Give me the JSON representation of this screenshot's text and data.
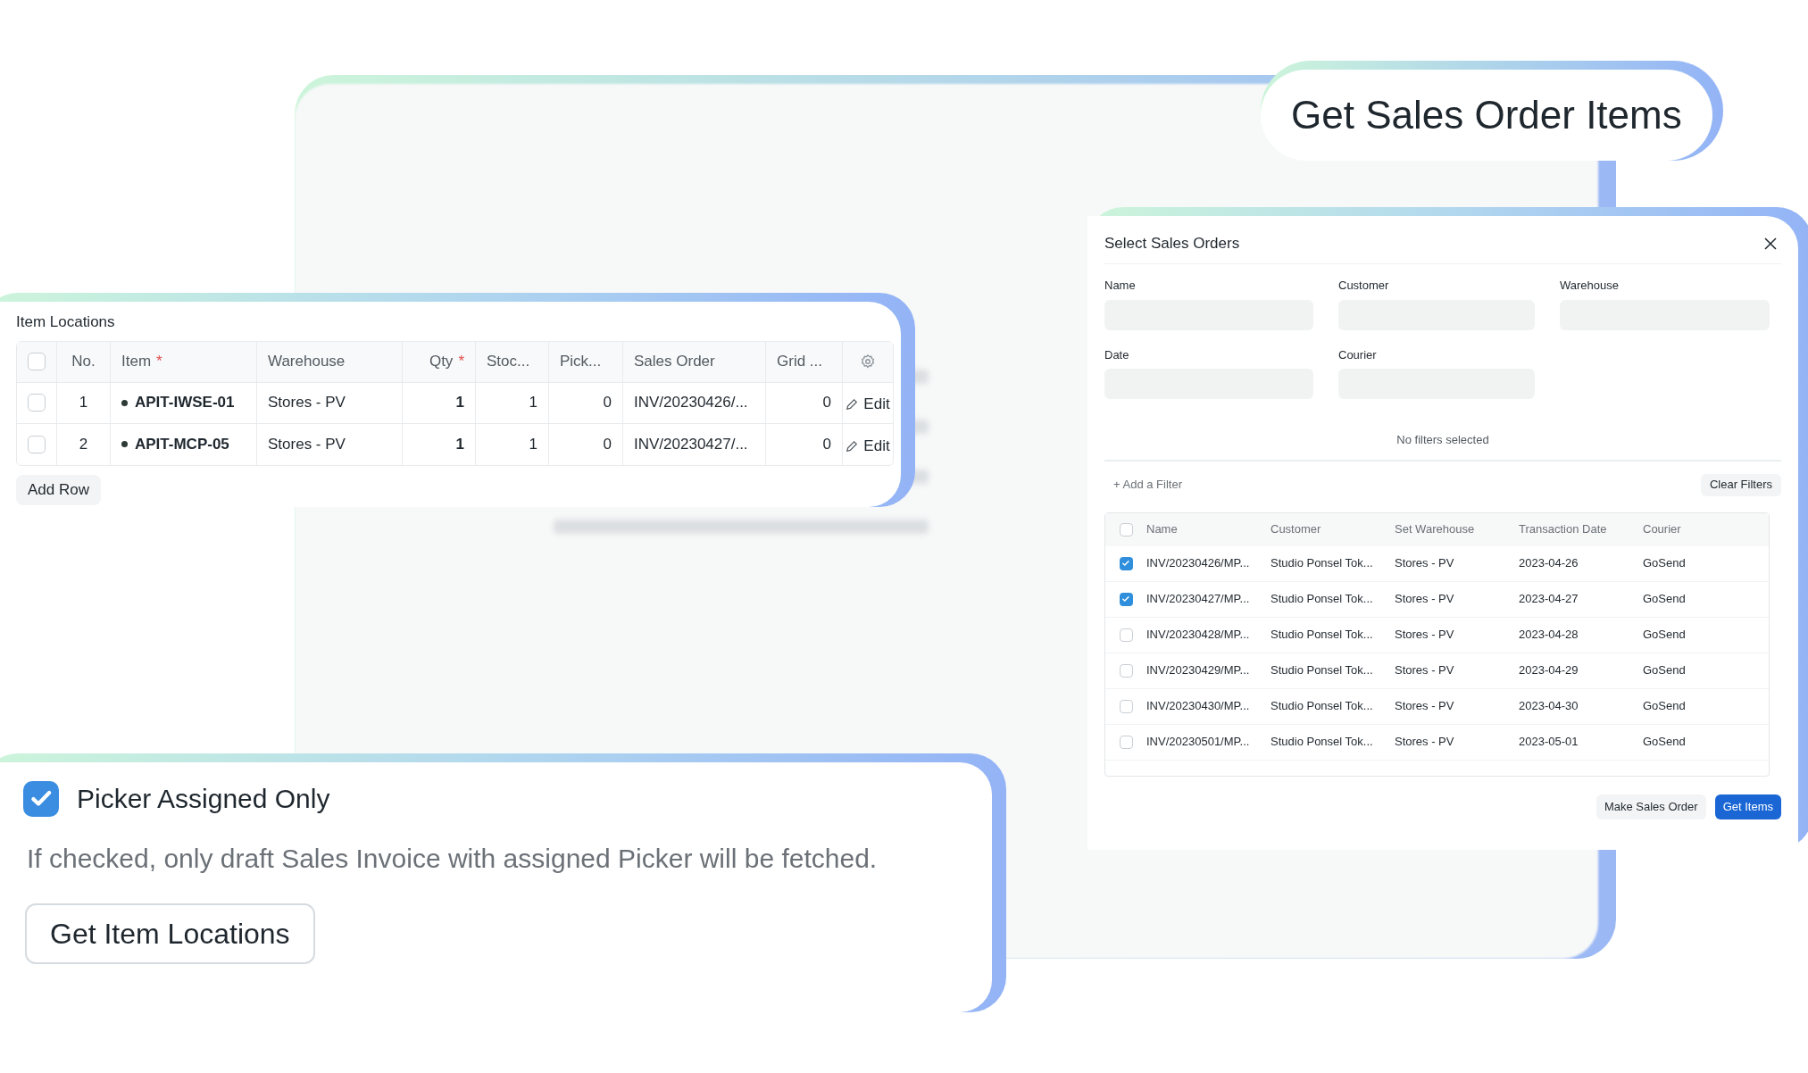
{
  "callout": {
    "title": "Get Sales Order Items"
  },
  "item_locations": {
    "title": "Item Locations",
    "select_all": {
      "checked": false
    },
    "columns": [
      {
        "label": "No."
      },
      {
        "label": "Item",
        "required_mark": "*"
      },
      {
        "label": "Warehouse"
      },
      {
        "label": "Qty",
        "required_mark": "*"
      },
      {
        "label": "Stoc..."
      },
      {
        "label": "Pick..."
      },
      {
        "label": "Sales Order"
      },
      {
        "label": "Grid ..."
      }
    ],
    "rows": [
      {
        "selected": false,
        "no": "1",
        "item": "APIT-IWSE-01",
        "warehouse": "Stores - PV",
        "qty": "1",
        "stock": "1",
        "picked": "0",
        "sales_order": "INV/20230426/...",
        "grid": "0",
        "edit": "Edit"
      },
      {
        "selected": false,
        "no": "2",
        "item": "APIT-MCP-05",
        "warehouse": "Stores - PV",
        "qty": "1",
        "stock": "1",
        "picked": "0",
        "sales_order": "INV/20230427/...",
        "grid": "0",
        "edit": "Edit"
      }
    ],
    "add_row": "Add Row"
  },
  "dialog": {
    "title": "Select Sales Orders",
    "fields": [
      {
        "label": "Name"
      },
      {
        "label": "Customer"
      },
      {
        "label": "Warehouse"
      },
      {
        "label": "Date"
      },
      {
        "label": "Courier"
      }
    ],
    "empty_state": "No filters selected",
    "add_filter": "+ Add a Filter",
    "clear_filters": "Clear Filters",
    "select_all": {
      "checked": false
    },
    "columns": [
      "Name",
      "Customer",
      "Set Warehouse",
      "Transaction Date",
      "Courier"
    ],
    "rows": [
      {
        "selected": true,
        "cells": [
          "INV/20230426/MP...",
          "Studio Ponsel Tok...",
          "Stores - PV",
          "2023-04-26",
          "GoSend"
        ]
      },
      {
        "selected": true,
        "cells": [
          "INV/20230427/MP...",
          "Studio Ponsel Tok...",
          "Stores - PV",
          "2023-04-27",
          "GoSend"
        ]
      },
      {
        "selected": false,
        "cells": [
          "INV/20230428/MP...",
          "Studio Ponsel Tok...",
          "Stores - PV",
          "2023-04-28",
          "GoSend"
        ]
      },
      {
        "selected": false,
        "cells": [
          "INV/20230429/MP...",
          "Studio Ponsel Tok...",
          "Stores - PV",
          "2023-04-29",
          "GoSend"
        ]
      },
      {
        "selected": false,
        "cells": [
          "INV/20230430/MP...",
          "Studio Ponsel Tok...",
          "Stores - PV",
          "2023-04-30",
          "GoSend"
        ]
      },
      {
        "selected": false,
        "cells": [
          "INV/20230501/MP...",
          "Studio Ponsel Tok...",
          "Stores - PV",
          "2023-05-01",
          "GoSend"
        ]
      }
    ],
    "buttons": [
      {
        "label": "Make Sales Order",
        "kind": "secondary"
      },
      {
        "label": "Get Items",
        "kind": "primary"
      }
    ]
  },
  "picker": {
    "checked": true,
    "label": "Picker Assigned Only",
    "description": "If checked, only draft Sales Invoice with assigned Picker will be fetched.",
    "button": "Get Item Locations"
  }
}
